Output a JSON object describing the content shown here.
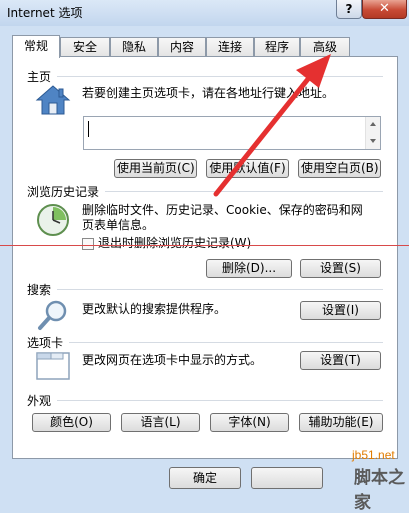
{
  "window": {
    "title": "Internet 选项",
    "help_label": "?",
    "close_label": "✕"
  },
  "tabs": [
    {
      "label": "常规"
    },
    {
      "label": "安全"
    },
    {
      "label": "隐私"
    },
    {
      "label": "内容"
    },
    {
      "label": "连接"
    },
    {
      "label": "程序"
    },
    {
      "label": "高级"
    }
  ],
  "home": {
    "section_label": "主页",
    "description": "若要创建主页选项卡，请在各地址行键入地址。",
    "buttons": {
      "use_current": "使用当前页(C)",
      "use_default": "使用默认值(F)",
      "use_blank": "使用空白页(B)"
    }
  },
  "history": {
    "section_label": "浏览历史记录",
    "description": "删除临时文件、历史记录、Cookie、保存的密码和网页表单信息。",
    "checkbox_label": "退出时删除浏览历史记录(W)",
    "checkbox_checked": false,
    "delete_label": "删除(D)...",
    "settings_label": "设置(S)"
  },
  "search": {
    "section_label": "搜索",
    "description": "更改默认的搜索提供程序。",
    "settings_label": "设置(I)"
  },
  "tabbed": {
    "section_label": "选项卡",
    "description": "更改网页在选项卡中显示的方式。",
    "settings_label": "设置(T)"
  },
  "appearance": {
    "section_label": "外观",
    "buttons": {
      "colors": "颜色(O)",
      "languages": "语言(L)",
      "fonts": "字体(N)",
      "accessibility": "辅助功能(E)"
    }
  },
  "footer": {
    "ok_label": "确定"
  },
  "watermark": {
    "site": "jb51.net",
    "name": "脚本之家"
  },
  "colors": {
    "annotation": "#e53030",
    "close_button": "#c84a35"
  }
}
